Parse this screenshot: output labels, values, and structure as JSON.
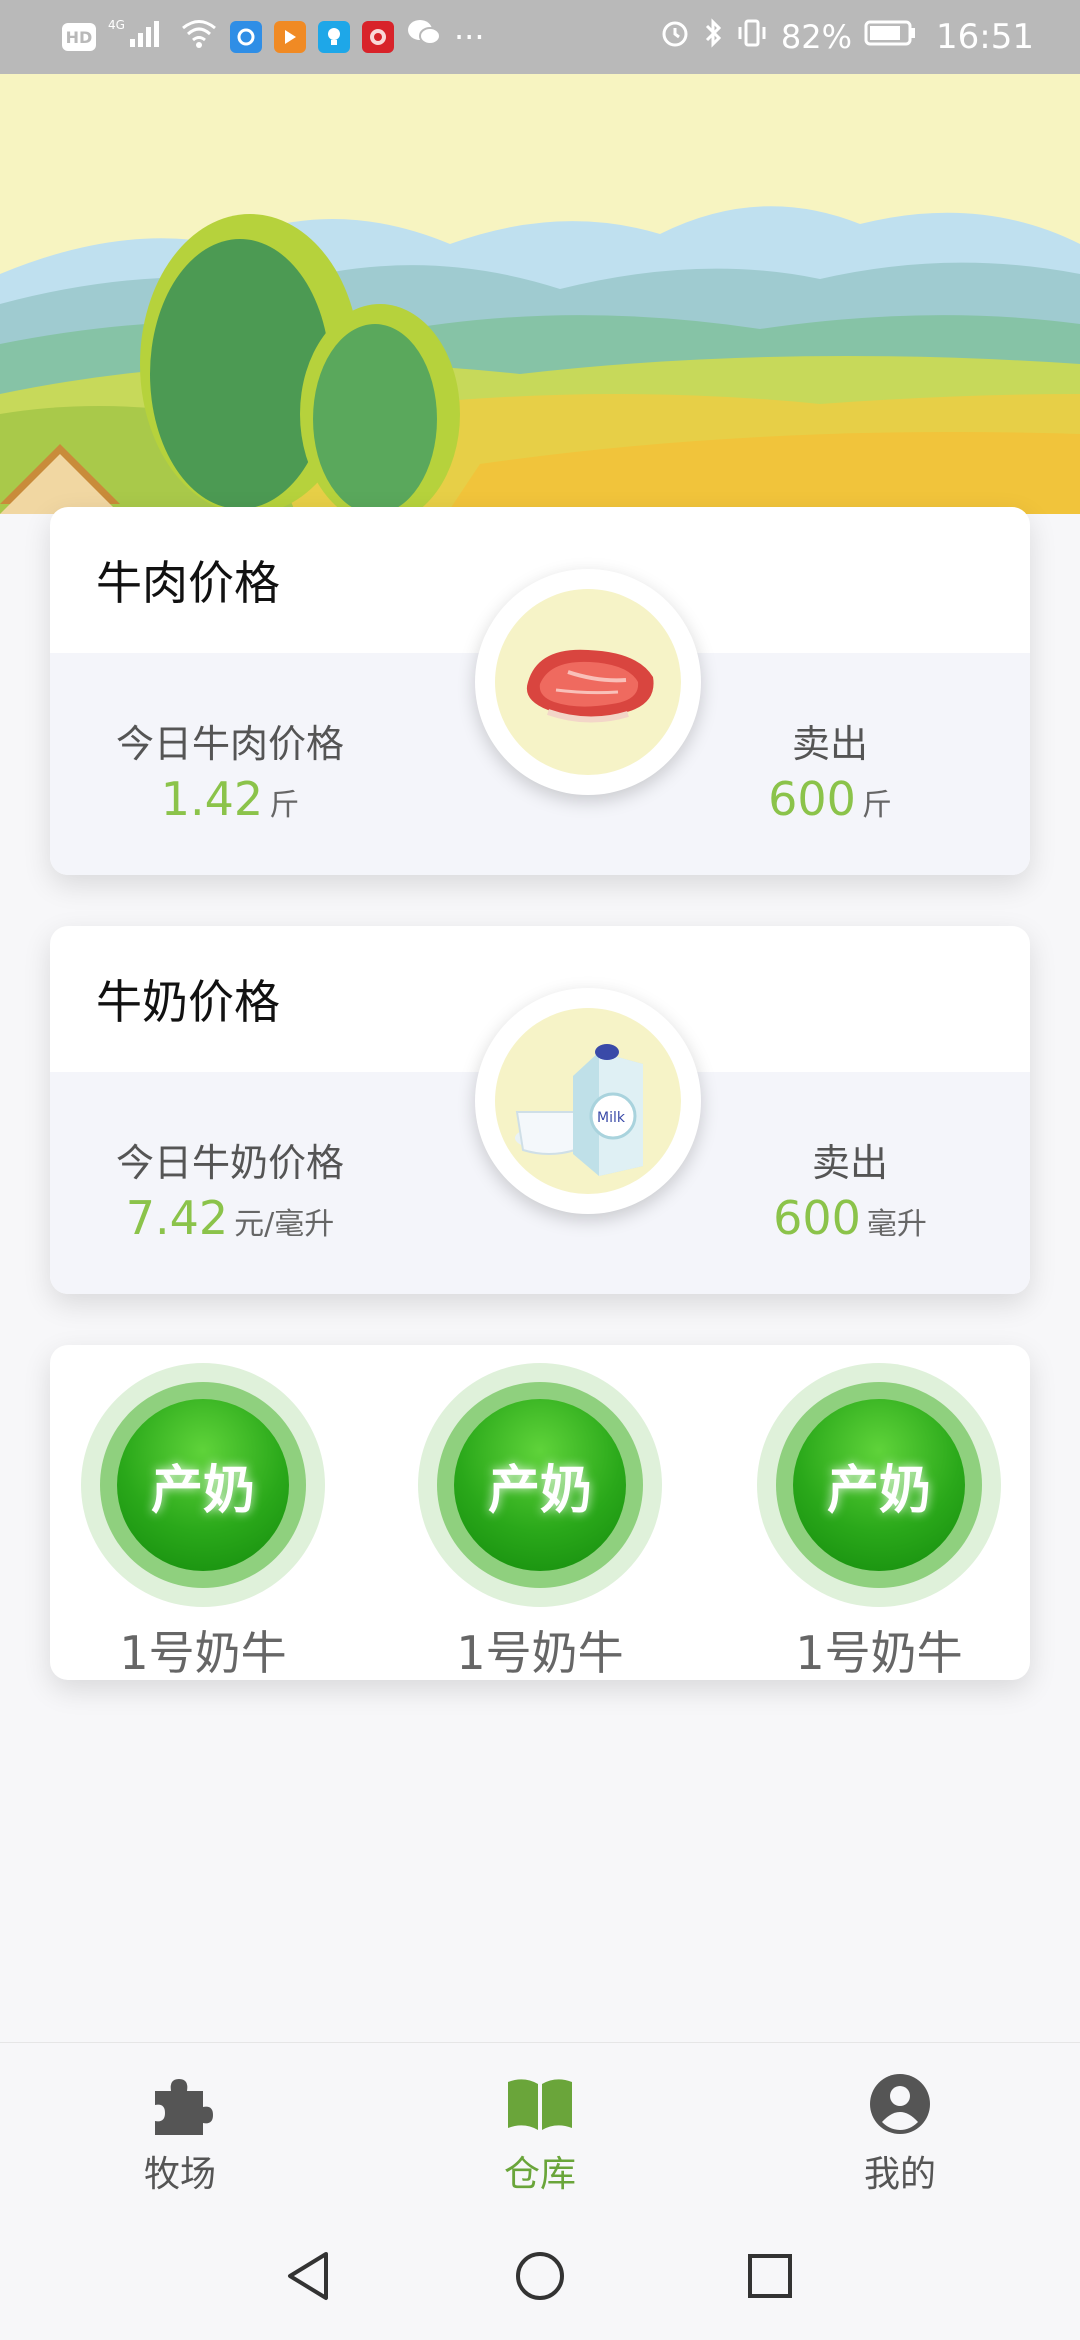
{
  "status_bar": {
    "left_icons": [
      "hd-icon",
      "signal-4g-icon",
      "wifi-icon",
      "app-icon-blue",
      "app-icon-orange",
      "app-icon-lightbulb",
      "app-icon-red",
      "wechat-icon"
    ],
    "hd_text": "HD",
    "more": "···",
    "battery_percent": "82%",
    "time": "16:51"
  },
  "beef_card": {
    "title": "牛肉价格",
    "left_label": "今日牛肉价格",
    "left_value": "1.42",
    "left_unit": "斤",
    "right_label": "卖出",
    "right_value": "600",
    "right_unit": "斤",
    "icon": "meat-icon"
  },
  "milk_card": {
    "title": "牛奶价格",
    "left_label": "今日牛奶价格",
    "left_value": "7.42",
    "left_unit": "元/毫升",
    "right_label": "卖出",
    "right_value": "600",
    "right_unit": "毫升",
    "icon": "milk-carton-icon",
    "carton_text": "Milk"
  },
  "cows": [
    {
      "button_label": "产奶",
      "name": "1号奶牛"
    },
    {
      "button_label": "产奶",
      "name": "1号奶牛"
    },
    {
      "button_label": "产奶",
      "name": "1号奶牛"
    }
  ],
  "bottom_nav": {
    "items": [
      {
        "label": "牧场",
        "icon": "puzzle-icon"
      },
      {
        "label": "仓库",
        "icon": "book-icon"
      },
      {
        "label": "我的",
        "icon": "user-icon"
      }
    ],
    "active_index": 1
  },
  "colors": {
    "accent_green": "#8bc34a",
    "nav_active": "#6aa53a",
    "button_green": "#2aa81a"
  }
}
